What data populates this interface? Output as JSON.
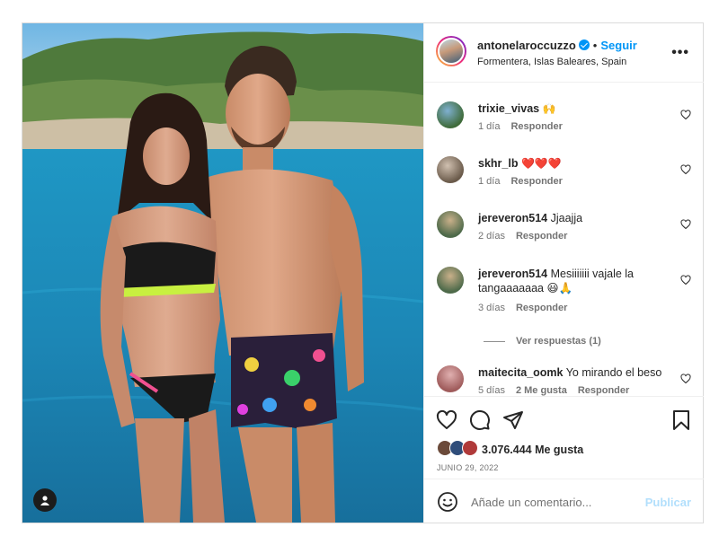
{
  "post": {
    "username": "antonelaroccuzzo",
    "follow_label": "Seguir",
    "separator": "•",
    "location": "Formentera, Islas Baleares, Spain",
    "more_label": "•••",
    "media_alt": "Photo of a couple in swimwear on a boat with turquoise sea and green hills behind"
  },
  "comments": [
    {
      "user": "trixie_vivas",
      "text": "🙌",
      "time": "1 día",
      "reply": "Responder",
      "likes": "",
      "avatar_color": "#3f6b3a"
    },
    {
      "user": "skhr_lb",
      "text": "❤️❤️❤️",
      "time": "1 día",
      "reply": "Responder",
      "likes": "",
      "avatar_color": "#8a7a6a"
    },
    {
      "user": "jereveron514",
      "text": "Jjaajja",
      "time": "2 días",
      "reply": "Responder",
      "likes": "",
      "avatar_color": "#4e6a4a"
    },
    {
      "user": "jereveron514",
      "text": "Mesiiiiiii vajale la tangaaaaaaa 😃🙏",
      "time": "3 días",
      "reply": "Responder",
      "likes": "",
      "avatar_color": "#4e6a4a"
    },
    {
      "user": "maitecita_oomk",
      "text": "Yo mirando el beso",
      "time": "5 días",
      "reply": "Responder",
      "likes": "2 Me gusta",
      "avatar_color": "#a05c5c"
    }
  ],
  "view_replies": "Ver respuestas (1)",
  "likes": {
    "count_text": "3.076.444 Me gusta",
    "liker_colors": [
      "#6b4a3a",
      "#2f4d7a",
      "#b03a3a"
    ]
  },
  "date": "JUNIO 29, 2022",
  "add_comment": {
    "placeholder": "Añade un comentario...",
    "publish_label": "Publicar"
  },
  "colors": {
    "accent": "#0095f6",
    "publish_disabled": "#b2dffc",
    "muted": "#737373",
    "sea": "#2a8fb8"
  }
}
